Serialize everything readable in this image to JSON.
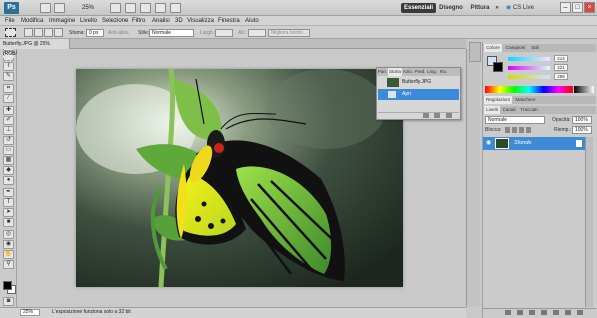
{
  "app": {
    "logo": "Ps",
    "zoom": "25%"
  },
  "workspaces": {
    "active": "Essenziali",
    "design": "Disegno",
    "paint": "Pittura",
    "more": "»",
    "cs_live": "CS Live"
  },
  "menu": [
    "File",
    "Modifica",
    "Immagine",
    "Livello",
    "Selezione",
    "Filtro",
    "Analisi",
    "3D",
    "Visualizza",
    "Finestra",
    "Aiuto"
  ],
  "options": {
    "sfuma_label": "Sfuma:",
    "sfuma_value": "0 px",
    "antialias": "Anti-alias",
    "stile_label": "Stile:",
    "stile_value": "Normale",
    "w_label": "Largh.:",
    "h_label": "Alt.:",
    "refine": "Migliora bordo..."
  },
  "document": {
    "tab_title": "Butterfly.JPG @ 25% (RGB/8)",
    "zoom": "25%",
    "status": "L'esposizione funziona solo a 32 bit"
  },
  "float_panel": {
    "tabs": [
      "Pan.",
      "Storia",
      "Azio.",
      "Pred.",
      "Ling.",
      "Ra."
    ],
    "snapshot": "Butterfly.JPG",
    "step": "Apri"
  },
  "color_panel": {
    "tabs": [
      "Colore",
      "Campioni",
      "Stili"
    ],
    "r": "214",
    "g": "221",
    "b": "255"
  },
  "adjust_panel": {
    "tabs": [
      "Regolazioni",
      "Maschere"
    ]
  },
  "layers_panel": {
    "tabs": [
      "Livelli",
      "Canali",
      "Tracciati"
    ],
    "blend": "Normale",
    "opacity_label": "Opacità:",
    "opacity": "100%",
    "lock_label": "Blocca:",
    "fill_label": "Riemp.:",
    "fill": "100%",
    "layer_name": "Sfondo"
  }
}
